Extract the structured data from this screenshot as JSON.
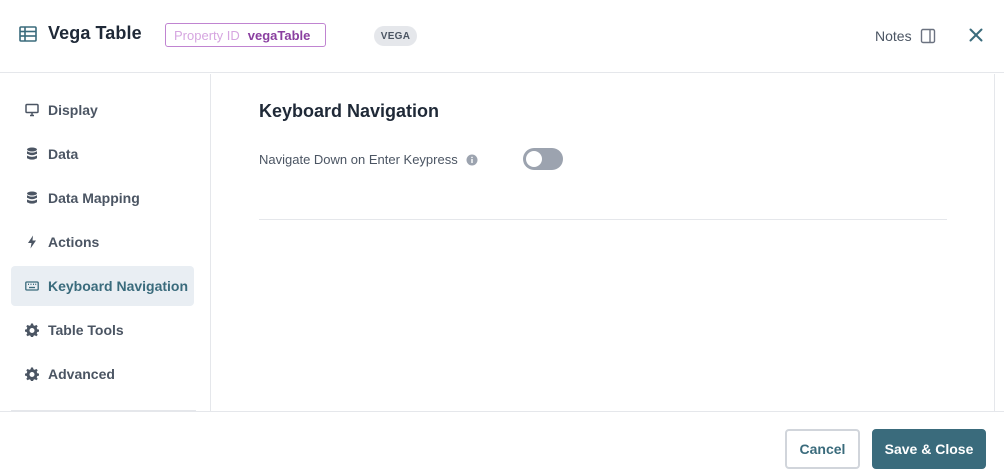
{
  "header": {
    "title": "Vega Table",
    "title_icon": "table-icon",
    "property_id_label": "Property ID",
    "property_id_value": "vegaTable",
    "badge": "VEGA",
    "notes_label": "Notes",
    "notes_icon": "panel-icon",
    "close_icon": "close-icon"
  },
  "sidebar": {
    "items": [
      {
        "label": "Display",
        "icon": "monitor-icon"
      },
      {
        "label": "Data",
        "icon": "database-icon"
      },
      {
        "label": "Data Mapping",
        "icon": "database-icon"
      },
      {
        "label": "Actions",
        "icon": "lightning-icon"
      },
      {
        "label": "Keyboard Navigation",
        "icon": "keyboard-icon",
        "active": true
      },
      {
        "label": "Table Tools",
        "icon": "gear-icon"
      },
      {
        "label": "Advanced",
        "icon": "gear-icon"
      }
    ]
  },
  "main": {
    "section_title": "Keyboard Navigation",
    "field_label": "Navigate Down on Enter Keypress",
    "field_info_icon": "info-icon",
    "toggle_on": false
  },
  "footer": {
    "cancel_label": "Cancel",
    "save_label": "Save & Close"
  },
  "colors": {
    "accent": "#3a6b7c",
    "active_bg": "#e9eef3",
    "property_border": "#c084d1",
    "property_value": "#8a3fa0",
    "toggle_off": "#9ca3af"
  }
}
